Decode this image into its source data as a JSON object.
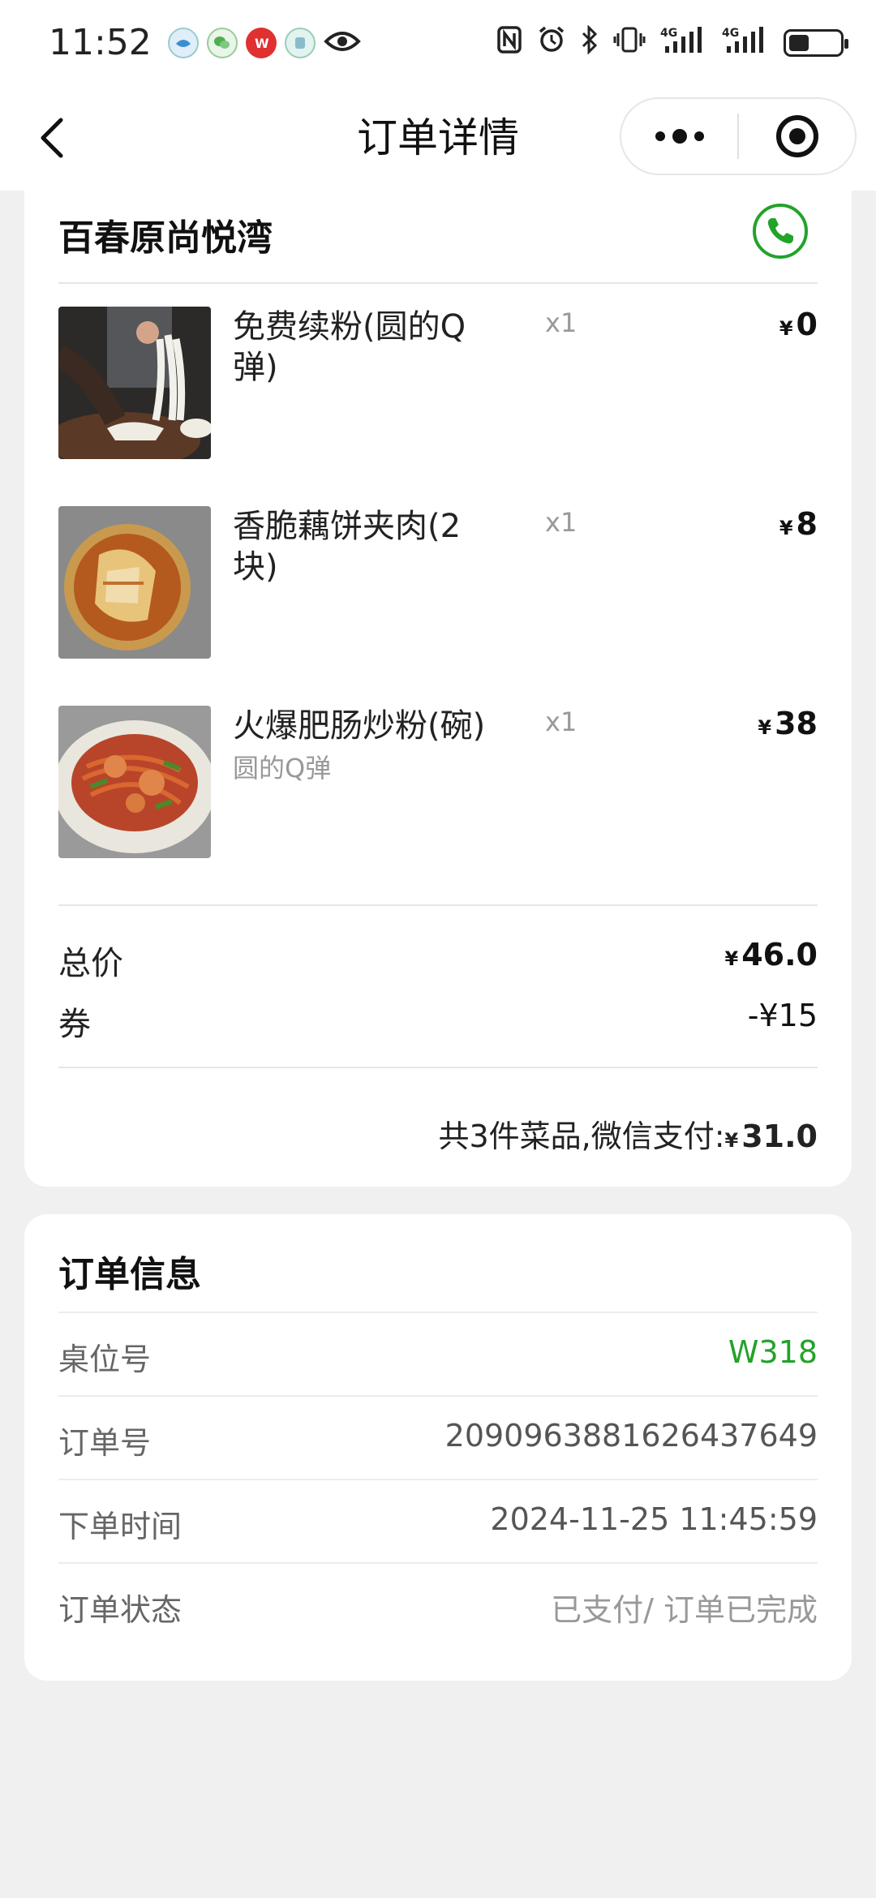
{
  "status_bar": {
    "time": "11:52",
    "left_icons": [
      "app-notification-icon",
      "wechat-icon",
      "weibo-icon",
      "app-icon",
      "eye-icon"
    ],
    "right_icons": [
      "nfc-icon",
      "alarm-icon",
      "bluetooth-icon",
      "vibrate-icon",
      "signal-4g-icon",
      "signal-4g-icon",
      "battery-icon"
    ],
    "network_1": "4G",
    "network_2": "4G"
  },
  "nav": {
    "title": "订单详情"
  },
  "shop": {
    "name": "百春原尚悦湾"
  },
  "dishes": [
    {
      "name": "免费续粉(圆的Q弹)",
      "spec": "",
      "qty": "x1",
      "currency": "¥",
      "price": "0"
    },
    {
      "name": "香脆藕饼夹肉(2块)",
      "spec": "",
      "qty": "x1",
      "currency": "¥",
      "price": "8"
    },
    {
      "name": "火爆肥肠炒粉(碗)",
      "spec": "圆的Q弹",
      "qty": "x1",
      "currency": "¥",
      "price": "38"
    }
  ],
  "summary": {
    "total_label": "总价",
    "total_currency": "¥",
    "total_value": "46.0",
    "coupon_label": "券",
    "coupon_value": "-¥15",
    "pay_text": "共3件菜品,微信支付:",
    "pay_currency": "¥",
    "pay_value": "31.0"
  },
  "order_info": {
    "title": "订单信息",
    "rows": [
      {
        "label": "桌位号",
        "value": "W318"
      },
      {
        "label": "订单号",
        "value": "2090963881626437649"
      },
      {
        "label": "下单时间",
        "value": "2024-11-25 11:45:59"
      },
      {
        "label": "订单状态",
        "value": "已支付/ 订单已完成"
      }
    ]
  },
  "colors": {
    "accent_green": "#22a32a",
    "background": "#f0f0f0"
  }
}
